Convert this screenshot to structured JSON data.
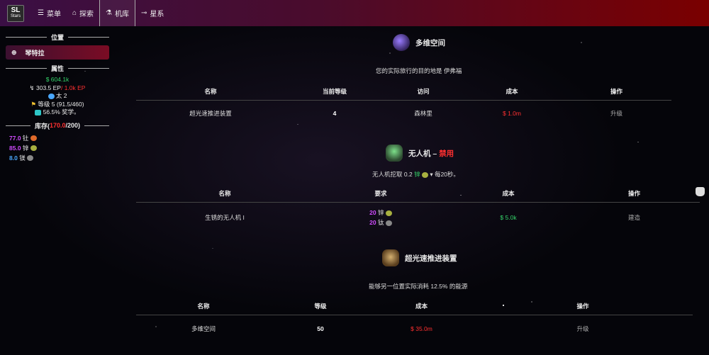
{
  "logo": {
    "line1": "SL",
    "line2": "Stars"
  },
  "nav": [
    {
      "icon": "☰",
      "label": "菜单"
    },
    {
      "icon": "⌂",
      "label": "探索"
    },
    {
      "icon": "⚗",
      "label": "机库"
    },
    {
      "icon": "⊸",
      "label": "星系"
    }
  ],
  "sidebar": {
    "location_title": "位置",
    "location": "琴特拉",
    "attributes_title": "属性",
    "money": "$ 604.1k",
    "ep_prefix": "↯ 303.5 EP",
    "ep_rate": "/ 1.0k EP",
    "sun": "太 2",
    "level": "等级 5 (91.5/460)",
    "bonus": "56.5% 奖学。",
    "inventory_title": "库存(",
    "inventory_used": "170.0",
    "inventory_max": "/200)",
    "items": [
      {
        "amount": "77.0",
        "name": "钍",
        "color": "#d14bff"
      },
      {
        "amount": "85.0",
        "name": "锌",
        "color": "#d14bff"
      },
      {
        "amount": "8.0",
        "name": "镁",
        "color": "#4aa8ff"
      }
    ]
  },
  "dimensional": {
    "title": "多维空间",
    "desc": "您的实际旅行的目的地是 伊弗福",
    "headers": [
      "名称",
      "当前等级",
      "访问",
      "成本",
      "操作"
    ],
    "row": {
      "name": "超光速推进装置",
      "level": "4",
      "visit": "森林里",
      "cost": "$ 1.0m",
      "action": "升级"
    }
  },
  "drone": {
    "title": "无人机",
    "status_sep": " – ",
    "status": "禁用",
    "desc_prefix": "无人机挖取 0.2",
    "desc_item": "锌",
    "desc_suffix": "▾ 每20秒。",
    "headers": [
      "名称",
      "要求",
      "成本",
      "操作"
    ],
    "row": {
      "name": "生锈的无人机 I",
      "req1_amount": "20",
      "req1_name": "锌",
      "req2_amount": "20",
      "req2_name": "钛",
      "cost": "$ 5.0k",
      "action": "建造"
    }
  },
  "ftl": {
    "title": "超光速推进装置",
    "desc": "能够另一位置实际消耗 12.5% 的能源",
    "headers": [
      "名称",
      "等级",
      "成本",
      "操作"
    ],
    "row": {
      "name": "多维空间",
      "level": "50",
      "cost": "$ 35.0m",
      "action": "升级"
    }
  },
  "colors": {
    "accent": "#7a0000",
    "green": "#35d46a",
    "red": "#ff3030",
    "purple": "#d14bff",
    "blue": "#4aa8ff"
  }
}
